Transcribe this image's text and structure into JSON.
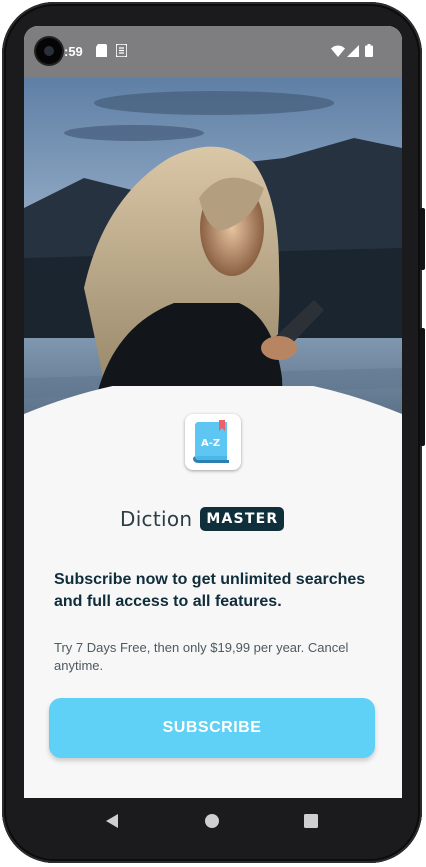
{
  "status_bar": {
    "time": ":59",
    "icons": [
      "camera-cutout",
      "sd-card-icon",
      "sim-icon",
      "wifi-icon",
      "signal-icon",
      "battery-icon"
    ]
  },
  "hero": {
    "image": "photo-woman-using-phone-at-dusk",
    "app_icon_label": "A-Z"
  },
  "brand": {
    "word": "Diction",
    "badge": "MASTER"
  },
  "headline": "Subscribe now to get unlimited searches and full access to all features.",
  "offer": "Try 7 Days Free, then only $19,99 per year. Cancel anytime.",
  "subscribe_button": "SUBSCRIBE",
  "nav": {
    "back": "back-icon",
    "home": "home-icon",
    "recents": "recents-icon"
  },
  "colors": {
    "accent": "#5fd0f6",
    "brand_dark": "#0f2f3a",
    "background": "#f7f7f8"
  }
}
